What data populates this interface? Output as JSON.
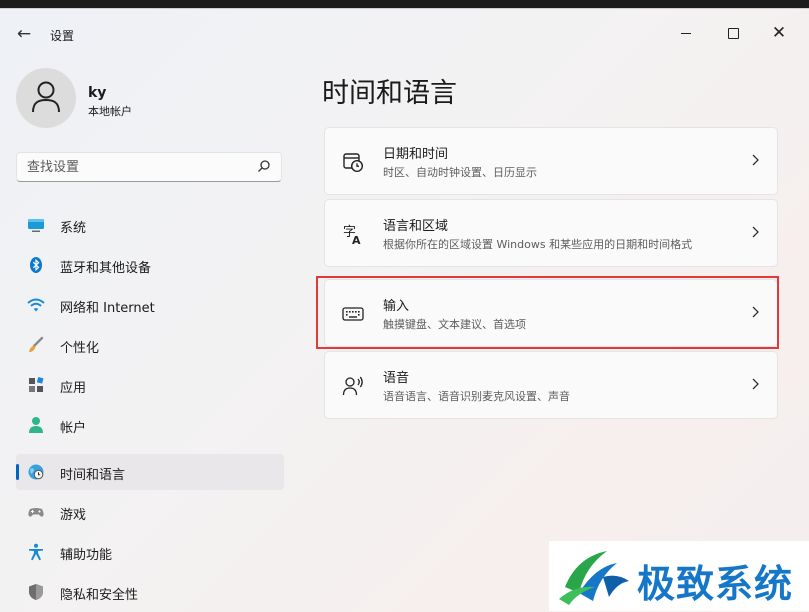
{
  "window": {
    "back_icon": "back-arrow-icon",
    "title": "设置",
    "controls": [
      "minimize-icon",
      "maximize-icon",
      "close-icon"
    ]
  },
  "profile": {
    "name": "ky",
    "account_type": "本地帐户"
  },
  "search": {
    "placeholder": "查找设置",
    "value": ""
  },
  "sidebar": {
    "items": [
      {
        "label": "系统",
        "icon": "monitor-icon",
        "active": false
      },
      {
        "label": "蓝牙和其他设备",
        "icon": "bluetooth-icon",
        "active": false
      },
      {
        "label": "网络和 Internet",
        "icon": "wifi-icon",
        "active": false
      },
      {
        "label": "个性化",
        "icon": "brush-icon",
        "active": false
      },
      {
        "label": "应用",
        "icon": "apps-icon",
        "active": false
      },
      {
        "label": "帐户",
        "icon": "person-icon",
        "active": false
      },
      {
        "label": "时间和语言",
        "icon": "globe-clock-icon",
        "active": true
      },
      {
        "label": "游戏",
        "icon": "gamepad-icon",
        "active": false
      },
      {
        "label": "辅助功能",
        "icon": "accessibility-icon",
        "active": false
      },
      {
        "label": "隐私和安全性",
        "icon": "shield-icon",
        "active": false
      }
    ]
  },
  "main": {
    "title": "时间和语言",
    "cards": [
      {
        "title": "日期和时间",
        "subtitle": "时区、自动时钟设置、日历显示",
        "icon": "calendar-clock-icon"
      },
      {
        "title": "语言和区域",
        "subtitle": "根据你所在的区域设置 Windows 和某些应用的日期和时间格式",
        "icon": "language-icon"
      },
      {
        "title": "输入",
        "subtitle": "触摸键盘、文本建议、首选项",
        "icon": "keyboard-icon",
        "highlighted": true
      },
      {
        "title": "语音",
        "subtitle": "语音语言、语音识别麦克风设置、声音",
        "icon": "speech-icon"
      }
    ]
  },
  "watermark": {
    "text": "极致系统",
    "color": "#1677c9"
  },
  "colors": {
    "accent": "#0067c0",
    "highlight_border": "#e03a3a"
  }
}
